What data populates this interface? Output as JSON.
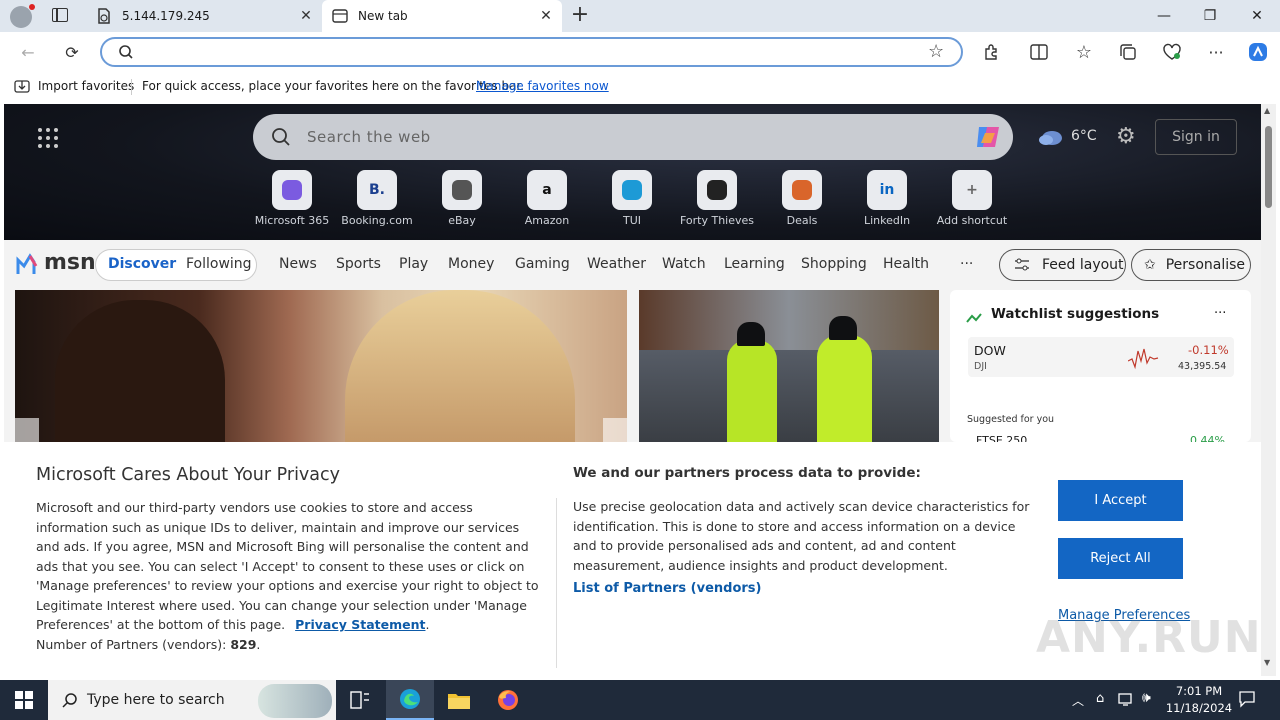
{
  "browser": {
    "tabs": [
      {
        "title": "5.144.179.245"
      },
      {
        "title": "New tab"
      }
    ],
    "address_value": "",
    "favorites_bar": {
      "import_label": "Import favorites",
      "message": "For quick access, place your favorites here on the favorites bar.",
      "manage_link": "Manage favorites now"
    }
  },
  "newtab": {
    "search_placeholder": "Search the web",
    "weather_temp": "6°C",
    "sign_in": "Sign in",
    "shortcuts": [
      {
        "label": "Microsoft 365",
        "tile_text": "",
        "color": "#7b5be0"
      },
      {
        "label": "Booking.com",
        "tile_text": "B.",
        "color": "#1b3f8f"
      },
      {
        "label": "eBay",
        "tile_text": "",
        "color": "#555"
      },
      {
        "label": "Amazon",
        "tile_text": "a",
        "color": "#111"
      },
      {
        "label": "TUI",
        "tile_text": "",
        "color": "#1d9ad6"
      },
      {
        "label": "Forty Thieves",
        "tile_text": "",
        "color": "#222"
      },
      {
        "label": "Deals",
        "tile_text": "",
        "color": "#d9652b"
      },
      {
        "label": "LinkedIn",
        "tile_text": "in",
        "color": "#0a66c2"
      },
      {
        "label": "Add shortcut",
        "tile_text": "+",
        "color": "#666"
      }
    ]
  },
  "msn": {
    "logo": "msn",
    "tabs": [
      "Discover",
      "Following"
    ],
    "nav": [
      "News",
      "Sports",
      "Play",
      "Money",
      "Gaming",
      "Weather",
      "Watch",
      "Learning",
      "Shopping",
      "Health"
    ],
    "more": "···",
    "feed_layout": "Feed layout",
    "personalise": "Personalise",
    "watchlist": {
      "title": "Watchlist suggestions",
      "more": "···",
      "stock": {
        "symbol": "DOW",
        "exchange": "DJI",
        "change": "-0.11%",
        "price": "43,395.54"
      },
      "suggested": "Suggested for you",
      "stock2": {
        "symbol": "FTSE 250",
        "change": "0.44%"
      }
    }
  },
  "consent": {
    "title": "Microsoft Cares About Your Privacy",
    "body": "Microsoft and our third-party vendors use cookies to store and access information such as unique IDs to deliver, maintain and improve our services and ads. If you agree, MSN and Microsoft Bing will personalise the content and ads that you see. You can select 'I Accept' to consent to these uses or click on 'Manage preferences' to review your options and exercise your right to object to Legitimate Interest where used.  You can change your selection under 'Manage Preferences' at the bottom of this page.",
    "privacy_link": "Privacy Statement",
    "partners_label": "Number of Partners (vendors):",
    "partners_count": "829",
    "right_title": "We and our partners process data to provide:",
    "right_body": "Use precise geolocation data and actively scan device characteristics for identification. This is done to store and access information on a device and to provide personalised ads and content, ad and content measurement, audience insights and product development.",
    "partners_link": "List of Partners (vendors)",
    "accept": "I Accept",
    "reject": "Reject All",
    "manage": "Manage Preferences"
  },
  "taskbar": {
    "search_placeholder": "Type here to search",
    "time": "7:01 PM",
    "date": "11/18/2024"
  },
  "watermark": "ANY.RUN"
}
